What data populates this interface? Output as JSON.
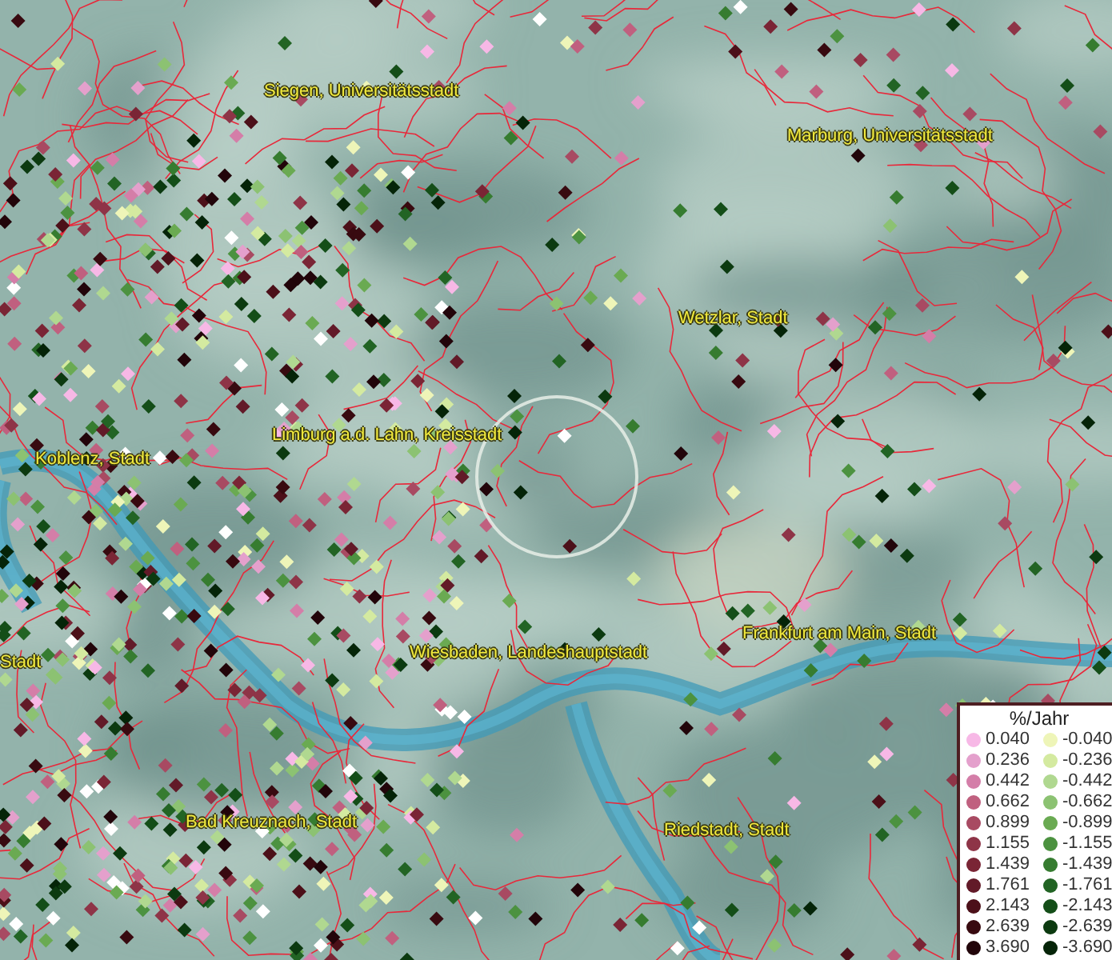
{
  "map": {
    "labels": [
      {
        "text": "Siegen, Universitätsstadt"
      },
      {
        "text": "Marburg, Universitätsstadt"
      },
      {
        "text": "Wetzlar, Stadt"
      },
      {
        "text": "Limburg a.d. Lahn, Kreisstadt"
      },
      {
        "text": "Koblenz, Stadt"
      },
      {
        "text": "Stadt"
      },
      {
        "text": "Wiesbaden, Landeshauptstadt"
      },
      {
        "text": "Frankfurt am Main, Stadt"
      },
      {
        "text": "Bad Kreuznach, Stadt"
      },
      {
        "text": "Riedstadt, Stadt"
      }
    ]
  },
  "legend": {
    "title": "%/Jahr",
    "rows": [
      {
        "positive": {
          "value": "0.040",
          "color": "#f7b8e6"
        },
        "negative": {
          "value": "-0.040",
          "color": "#eef5b8"
        }
      },
      {
        "positive": {
          "value": "0.236",
          "color": "#e4a0cc"
        },
        "negative": {
          "value": "-0.236",
          "color": "#d4eaa0"
        }
      },
      {
        "positive": {
          "value": "0.442",
          "color": "#d47ea8"
        },
        "negative": {
          "value": "-0.442",
          "color": "#b0d890"
        }
      },
      {
        "positive": {
          "value": "0.662",
          "color": "#c0607f"
        },
        "negative": {
          "value": "-0.662",
          "color": "#8cc272"
        }
      },
      {
        "positive": {
          "value": "0.899",
          "color": "#a84a62"
        },
        "negative": {
          "value": "-0.899",
          "color": "#6aaa52"
        }
      },
      {
        "positive": {
          "value": "1.155",
          "color": "#8e3447"
        },
        "negative": {
          "value": "-1.155",
          "color": "#4c9240"
        }
      },
      {
        "positive": {
          "value": "1.439",
          "color": "#7a2535"
        },
        "negative": {
          "value": "-1.439",
          "color": "#367c30"
        }
      },
      {
        "positive": {
          "value": "1.761",
          "color": "#621a28"
        },
        "negative": {
          "value": "-1.761",
          "color": "#226424"
        }
      },
      {
        "positive": {
          "value": "2.143",
          "color": "#4c1019"
        },
        "negative": {
          "value": "-2.143",
          "color": "#144e18"
        }
      },
      {
        "positive": {
          "value": "2.639",
          "color": "#380a10"
        },
        "negative": {
          "value": "-2.639",
          "color": "#0c3a10"
        }
      },
      {
        "positive": {
          "value": "3.690",
          "color": "#22050a"
        },
        "negative": {
          "value": "-3.690",
          "color": "#052408"
        }
      }
    ]
  }
}
